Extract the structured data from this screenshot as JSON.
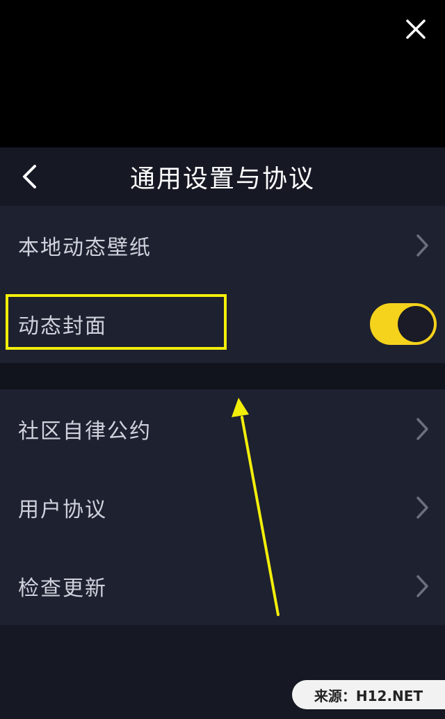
{
  "header": {
    "title": "通用设置与协议"
  },
  "icons": {
    "close": "close-icon",
    "back": "chevron-left-icon",
    "row_chevron": "chevron-right-icon"
  },
  "sections": {
    "group1": [
      {
        "label": "本地动态壁纸",
        "control": "chevron"
      },
      {
        "label": "动态封面",
        "control": "toggle",
        "toggle_on": true
      }
    ],
    "group2": [
      {
        "label": "社区自律公约",
        "control": "chevron"
      },
      {
        "label": "用户协议",
        "control": "chevron"
      },
      {
        "label": "检查更新",
        "control": "chevron"
      }
    ]
  },
  "colors": {
    "toggle_on": "#f5d21c",
    "annotation": "#f2ee0a",
    "panel_bg": "#161824",
    "row_bg": "#1e2130"
  },
  "watermark": {
    "text": "来源：H12.NET"
  }
}
